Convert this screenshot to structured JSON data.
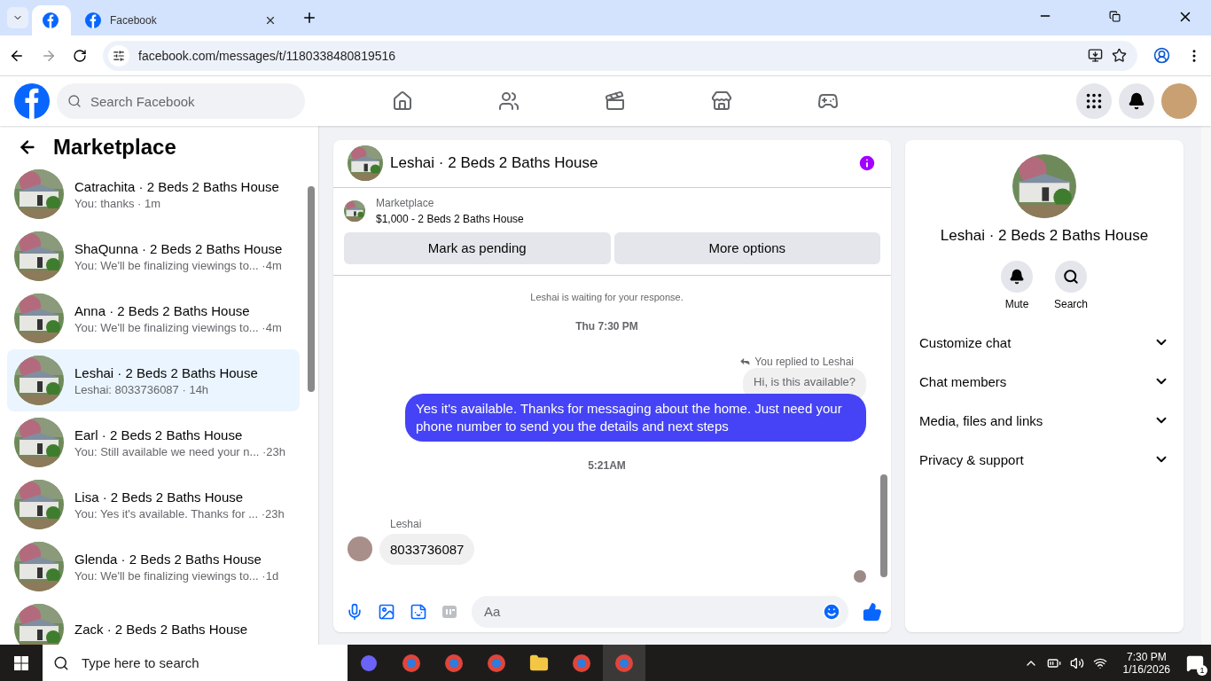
{
  "browser": {
    "tabs": [
      {
        "selected": true
      },
      {
        "title": "Facebook",
        "selected": false
      }
    ],
    "url": "facebook.com/messages/t/1180338480819516"
  },
  "header": {
    "search_placeholder": "Search Facebook"
  },
  "sidebar": {
    "title": "Marketplace",
    "conversations": [
      {
        "name": "Catrachita · 2 Beds 2 Baths House",
        "preview": "You: thanks",
        "time": "· 1m",
        "selected": false
      },
      {
        "name": "ShaQunna · 2 Beds 2 Baths House",
        "preview": "You: We'll be finalizing viewings to...",
        "time": "·4m",
        "selected": false
      },
      {
        "name": "Anna · 2 Beds 2 Baths House",
        "preview": "You: We'll be finalizing viewings to...",
        "time": "·4m",
        "selected": false
      },
      {
        "name": "Leshai · 2 Beds 2 Baths House",
        "preview": "Leshai: 8033736087",
        "time": "· 14h",
        "selected": true
      },
      {
        "name": "Earl · 2 Beds 2 Baths House",
        "preview": "You: Still available we need your n...",
        "time": "·23h",
        "selected": false
      },
      {
        "name": "Lisa · 2 Beds 2 Baths House",
        "preview": "You: Yes it's available. Thanks for ...",
        "time": "·23h",
        "selected": false
      },
      {
        "name": "Glenda · 2 Beds 2 Baths House",
        "preview": "You: We'll be finalizing viewings to...",
        "time": "·1d",
        "selected": false
      },
      {
        "name": "Zack · 2 Beds 2 Baths House",
        "selected": false
      }
    ]
  },
  "chat": {
    "title": "Leshai · 2 Beds 2 Baths House",
    "listing": {
      "label": "Marketplace",
      "title": "$1,000 - 2 Beds 2 Baths House"
    },
    "buttons": [
      "Mark as pending",
      "More options"
    ],
    "messages": [
      {
        "kind": "notice",
        "text": "Leshai is waiting for your response."
      },
      {
        "kind": "time",
        "text": "Thu 7:30 PM"
      },
      {
        "kind": "reply",
        "note": "You replied to Leshai",
        "quote": "Hi, is this available?"
      },
      {
        "kind": "outgoing",
        "text": "Yes it's available. Thanks for messaging about the home. Just need your phone number to send you the details and next steps"
      },
      {
        "kind": "time",
        "text": "5:21AM"
      },
      {
        "kind": "incoming",
        "sender": "Leshai",
        "text": "8033736087"
      }
    ],
    "composer_placeholder": "Aa"
  },
  "details": {
    "name": "Leshai · 2 Beds 2 Baths House",
    "actions": [
      {
        "kind": "mute",
        "label": "Mute"
      },
      {
        "kind": "search",
        "label": "Search"
      }
    ],
    "sections": [
      {
        "label": "Customize chat",
        "expanded": false
      },
      {
        "label": "Chat members",
        "expanded": false
      },
      {
        "label": "Media, files and links",
        "expanded": false
      },
      {
        "label": "Privacy & support",
        "expanded": false
      }
    ]
  },
  "taskbar": {
    "search_placeholder": "Type here to search",
    "time": "7:30 PM",
    "date": "1/16/2026",
    "notifications": "1"
  }
}
